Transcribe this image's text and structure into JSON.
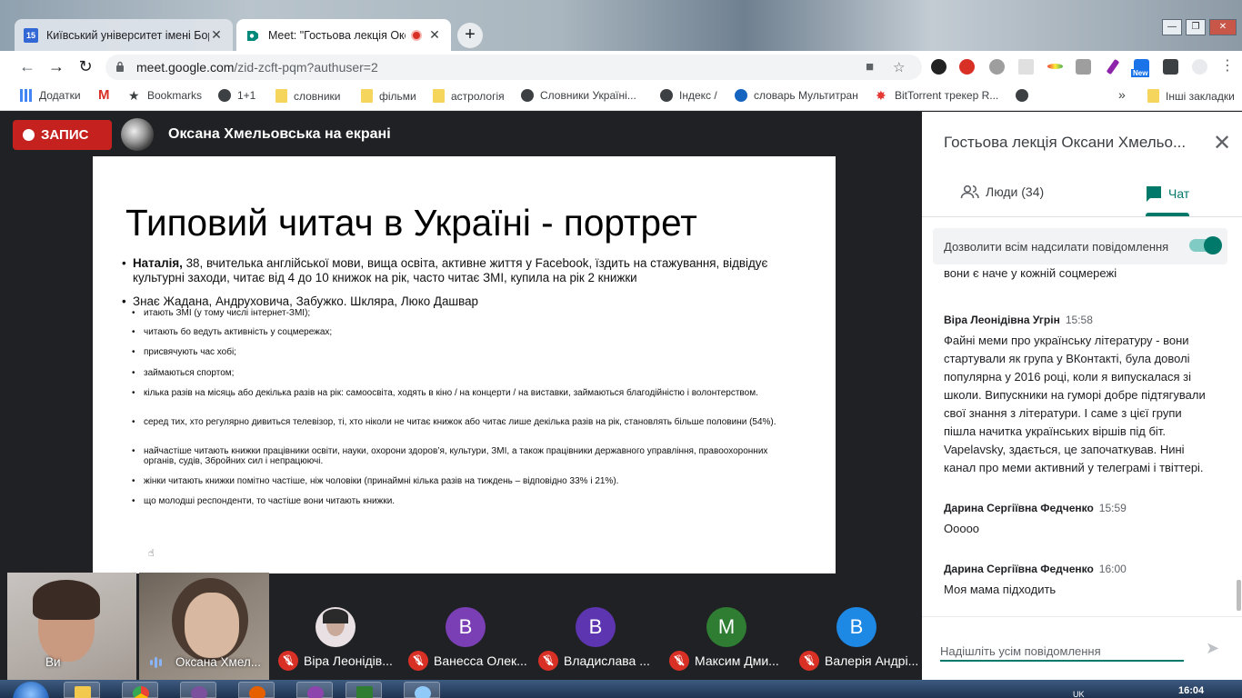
{
  "browser": {
    "tabs": [
      {
        "title": "Київський університет імені Бор",
        "favicon_text": "15",
        "favicon_color": "#3367d6",
        "active": false
      },
      {
        "title": "Meet: \"Гостьова лекція Окса",
        "favicon_color": "#00897b",
        "active": true
      }
    ],
    "url_host": "meet.google.com",
    "url_path": "/zid-zcft-pqm?authuser=2",
    "new_badge": "New",
    "bookmarks": [
      {
        "label": "Додатки",
        "icon": "apps-grid-icon"
      },
      {
        "label": "",
        "icon": "gmail-icon"
      },
      {
        "label": "Bookmarks",
        "icon": "star-icon"
      },
      {
        "label": "1+1",
        "icon": "globe-icon"
      },
      {
        "label": "словники",
        "icon": "folder-icon"
      },
      {
        "label": "фільми",
        "icon": "folder-icon"
      },
      {
        "label": "астрологія",
        "icon": "folder-icon"
      },
      {
        "label": "Словники Україні...",
        "icon": "globe-icon"
      },
      {
        "label": "Індекс /",
        "icon": "globe-icon"
      },
      {
        "label": "словарь Мультитран",
        "icon": "multitran-icon"
      },
      {
        "label": "BitTorrent трекер R...",
        "icon": "torrent-icon"
      },
      {
        "label": "",
        "icon": "globe-icon"
      }
    ],
    "more_bookmarks": "»",
    "other_bookmarks": "Інші закладки"
  },
  "meet": {
    "record_label": "ЗАПИС",
    "presenter_label": "Оксана Хмельовська на екрані",
    "slide": {
      "title": "Типовий читач в Україні - портрет",
      "bullet1_bold": "Наталія,",
      "bullet1_text": " 38, вчителька англійської мови, вища освіта, активне життя у Facebook, їздить на стажування, відвідує культурні заходи, читає від 4 до 10 книжок на рік, часто читає ЗМІ, купила на рік 2 книжки",
      "bullet2": "Знає Жадана, Андруховича, Забужко. Шкляра, Люко Дашвар",
      "small_bullets": [
        "итають ЗМІ (у тому числі інтернет-ЗМІ);",
        "читають бо ведуть активність у соцмережах;",
        "присвячують час хобі;",
        "займаються спортом;",
        "кілька разів на місяць або декілька разів на рік: самоосвіта,  ходять в кіно / на концерти / на виставки, займаються благодійністю і волонтерством.",
        "серед тих, хто регулярно дивиться телевізор, ті, хто ніколи не читає книжок або читає лише декілька разів на рік, становлять більше половини (54%).",
        "найчастіше читають книжки працівники освіти, науки,  охорони здоров’я, культури, ЗМІ, а також працівники державного управління, правоохоронних органів, судів, Збройних сил і непрацюючі.",
        "жінки читають книжки помітно частіше, ніж чоловіки (принаймні кілька разів на тиждень – відповідно 33% і 21%).",
        "що молодші респонденти, то частіше вони читають книжки."
      ]
    },
    "camera_tiles": [
      {
        "label": "Ви"
      },
      {
        "label": "Оксана Хмел..."
      }
    ],
    "participants": [
      {
        "name": "Віра Леонідів...",
        "initial": "",
        "color": "#e8e0e3"
      },
      {
        "name": "Ванесса Олек...",
        "initial": "В",
        "color": "#7b3fb5"
      },
      {
        "name": "Владислава ...",
        "initial": "В",
        "color": "#5e35b1"
      },
      {
        "name": "Максим Дми...",
        "initial": "М",
        "color": "#2e7d32"
      },
      {
        "name": "Валерія Андрі...",
        "initial": "В",
        "color": "#1e88e5"
      }
    ]
  },
  "panel": {
    "title": "Гостьова лекція Оксани Хмельо...",
    "people_tab": "Люди (34)",
    "chat_tab": "Чат",
    "allow_label": "Дозволити всім надсилати повідомлення",
    "partial_message": "вони є наче у кожній соцмережі",
    "messages": [
      {
        "author": "Віра Леонідівна Угрін",
        "time": "15:58",
        "text": "Файні меми про українську літературу - вони стартували як група у ВКонтакті, була доволі популярна у 2016 році, коли я випускалася зі школи. Випускники на гуморі добре підтягували свої знання з літератури. І саме з цієї групи пішла начитка українських віршів під біт. Vapelavsky, здається, це започаткував. Нині канал про меми активний у телеграмі і твіттері."
      },
      {
        "author": "Дарина Сергіївна Федченко",
        "time": "15:59",
        "text": "Ооооо"
      },
      {
        "author": "Дарина Сергіївна Федченко",
        "time": "16:00",
        "text": "Моя мама підходить"
      }
    ],
    "compose_placeholder": "Надішліть усім повідомлення"
  },
  "taskbar": {
    "clock": "16:04",
    "lang": "UK"
  }
}
